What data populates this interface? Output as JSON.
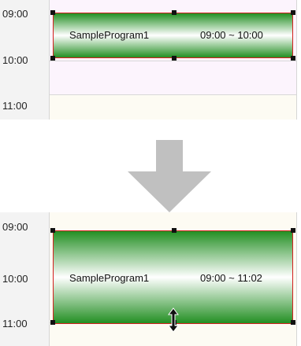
{
  "top_view": {
    "times": [
      "09:00",
      "10:00",
      "11:00"
    ],
    "event": {
      "name": "SampleProgram1",
      "time_range": "09:00 ~ 10:00"
    }
  },
  "transition": {
    "icon": "arrow-down-icon",
    "color": "#c0c0c0"
  },
  "bottom_view": {
    "times": [
      "09:00",
      "10:00",
      "11:00"
    ],
    "event": {
      "name": "SampleProgram1",
      "time_range": "09:00 ~ 11:02"
    },
    "cursor": "resize-vertical-icon"
  },
  "colors": {
    "event_green": "#238f23",
    "event_border": "#d42020",
    "band_lavender": "#fcf4fd",
    "band_cream": "#fdfbf3"
  }
}
